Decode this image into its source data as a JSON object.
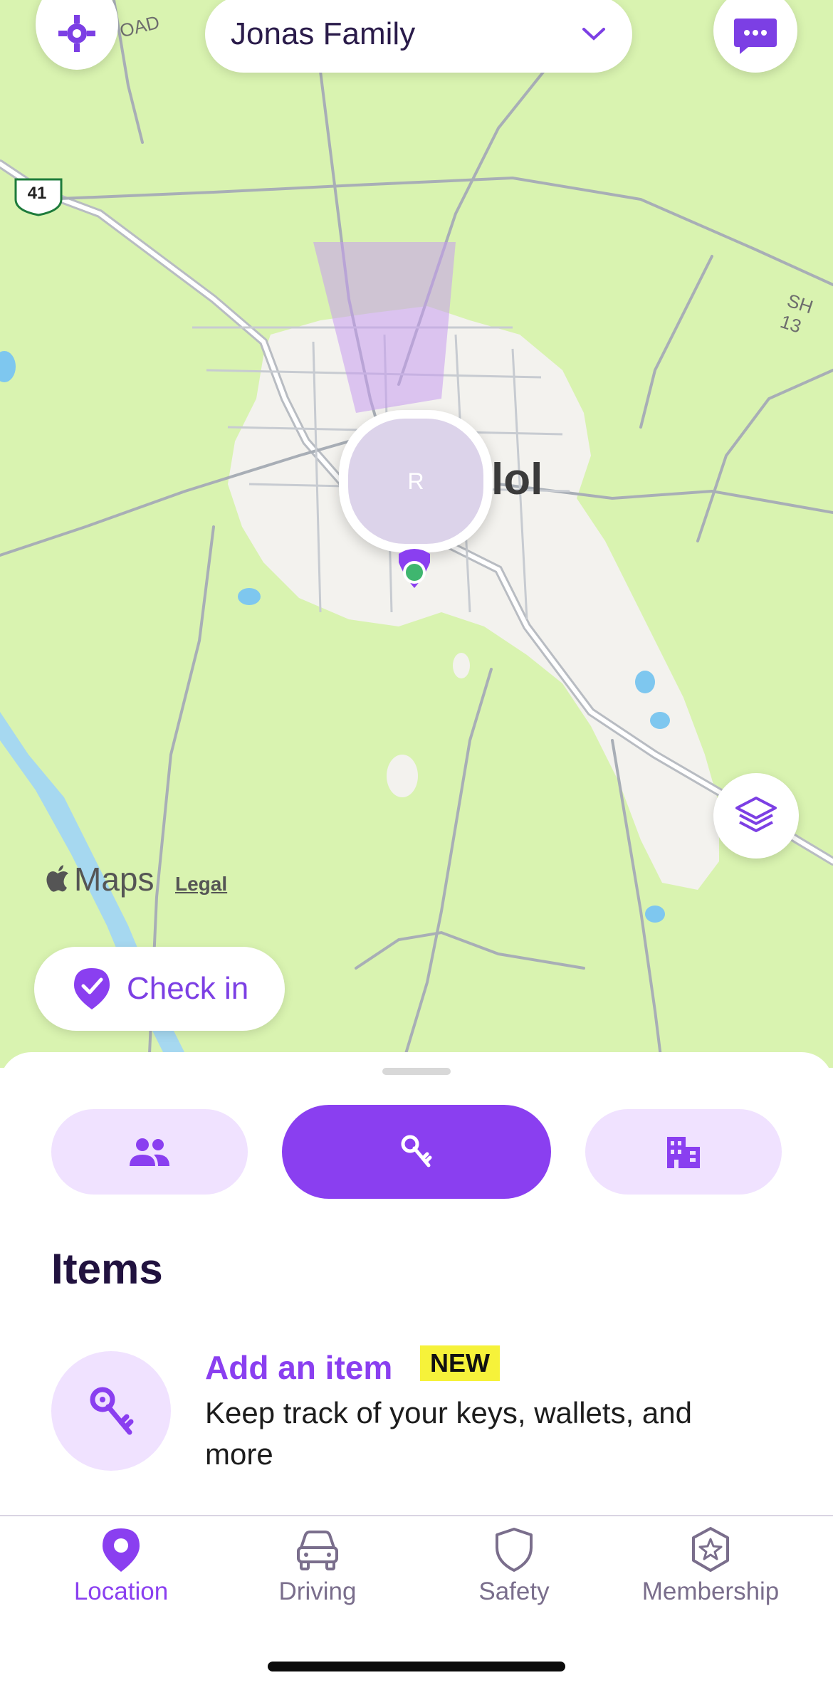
{
  "map": {
    "road_label_1": "OAD",
    "road_label_2": "SH 13",
    "highway_shield": "41",
    "town_label": "lol",
    "avatar_initial": "R",
    "attribution": "Maps",
    "legal": "Legal"
  },
  "header": {
    "circle_name": "Jonas Family",
    "chevron_icon": "chevron-down-icon",
    "messages_icon": "chat-icon",
    "settings_icon": "gear-icon"
  },
  "checkin": {
    "label": "Check in",
    "icon": "check-pin-icon"
  },
  "sheet": {
    "segments": [
      {
        "name": "people",
        "icon": "people-icon",
        "active": false
      },
      {
        "name": "items",
        "icon": "keys-icon",
        "active": true
      },
      {
        "name": "places",
        "icon": "buildings-icon",
        "active": false
      }
    ],
    "section_title": "Items",
    "item": {
      "title": "Add an item",
      "badge": "NEW",
      "description": "Keep track of your keys, wallets, and more"
    }
  },
  "tabs": [
    {
      "label": "Location",
      "icon": "location-pin-icon",
      "active": true
    },
    {
      "label": "Driving",
      "icon": "car-icon",
      "active": false
    },
    {
      "label": "Safety",
      "icon": "shield-icon",
      "active": false
    },
    {
      "label": "Membership",
      "icon": "star-badge-icon",
      "active": false
    }
  ],
  "colors": {
    "accent": "#8a3ff0",
    "map_bg": "#d9f3b0",
    "segment_off": "#f0e2ff"
  }
}
